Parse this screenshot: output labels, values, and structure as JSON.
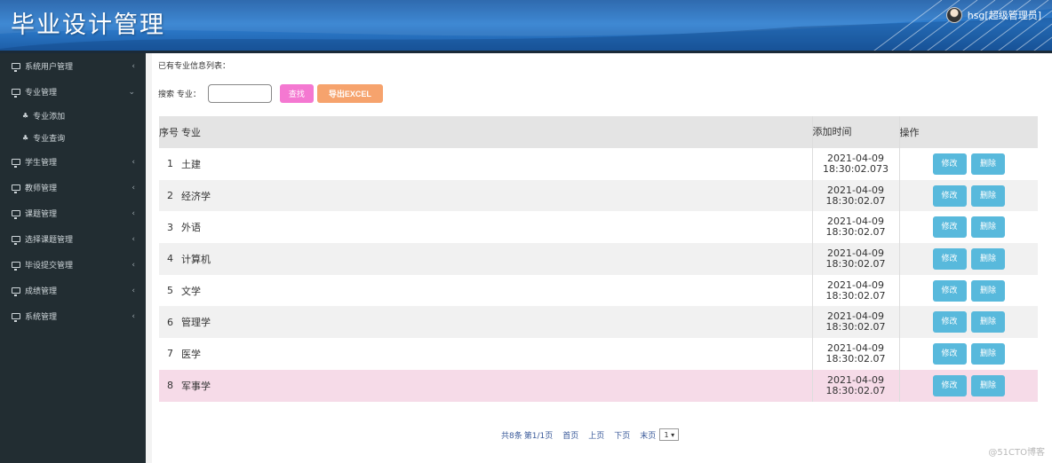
{
  "header": {
    "app_title": "毕业设计管理",
    "user_label": "hsg[超级管理员]"
  },
  "sidebar": {
    "items": [
      {
        "label": "系统用户管理",
        "chevron": "‹"
      },
      {
        "label": "专业管理",
        "chevron": "⌄",
        "children": [
          {
            "label": "专业添加"
          },
          {
            "label": "专业查询"
          }
        ]
      },
      {
        "label": "学生管理",
        "chevron": "‹"
      },
      {
        "label": "教师管理",
        "chevron": "‹"
      },
      {
        "label": "课题管理",
        "chevron": "‹"
      },
      {
        "label": "选择课题管理",
        "chevron": "‹"
      },
      {
        "label": "毕设提交管理",
        "chevron": "‹"
      },
      {
        "label": "成绩管理",
        "chevron": "‹"
      },
      {
        "label": "系统管理",
        "chevron": "‹"
      }
    ]
  },
  "main": {
    "list_caption": "已有专业信息列表：",
    "search": {
      "label": "搜索  专业：",
      "value": "",
      "find_button": "查找",
      "export_button": "导出EXCEL"
    },
    "table": {
      "headers": {
        "idx": "序号",
        "major": "专业",
        "time": "添加时间",
        "ops": "操作"
      },
      "rows": [
        {
          "idx": "1",
          "major": "土建",
          "date": "2021-04-09",
          "time": "18:30:02.073"
        },
        {
          "idx": "2",
          "major": "经济学",
          "date": "2021-04-09",
          "time": "18:30:02.07"
        },
        {
          "idx": "3",
          "major": "外语",
          "date": "2021-04-09",
          "time": "18:30:02.07"
        },
        {
          "idx": "4",
          "major": "计算机",
          "date": "2021-04-09",
          "time": "18:30:02.07"
        },
        {
          "idx": "5",
          "major": "文学",
          "date": "2021-04-09",
          "time": "18:30:02.07"
        },
        {
          "idx": "6",
          "major": "管理学",
          "date": "2021-04-09",
          "time": "18:30:02.07"
        },
        {
          "idx": "7",
          "major": "医学",
          "date": "2021-04-09",
          "time": "18:30:02.07"
        },
        {
          "idx": "8",
          "major": "军事学",
          "date": "2021-04-09",
          "time": "18:30:02.07"
        }
      ],
      "edit_label": "修改",
      "delete_label": "删除"
    },
    "pager": {
      "total": "共8条",
      "page": "第1/1页",
      "first": "首页",
      "prev": "上页",
      "next": "下页",
      "last": "末页",
      "select_value": "1 ▾"
    }
  },
  "watermark": "@51CTO博客",
  "colors": {
    "sidebar_bg": "#222d32",
    "header_blue": "#2f7fd0",
    "find_button": "#f478d1",
    "export_button": "#f6a36d",
    "op_button": "#58b9dc",
    "highlight_row": "#f6dbe8"
  }
}
